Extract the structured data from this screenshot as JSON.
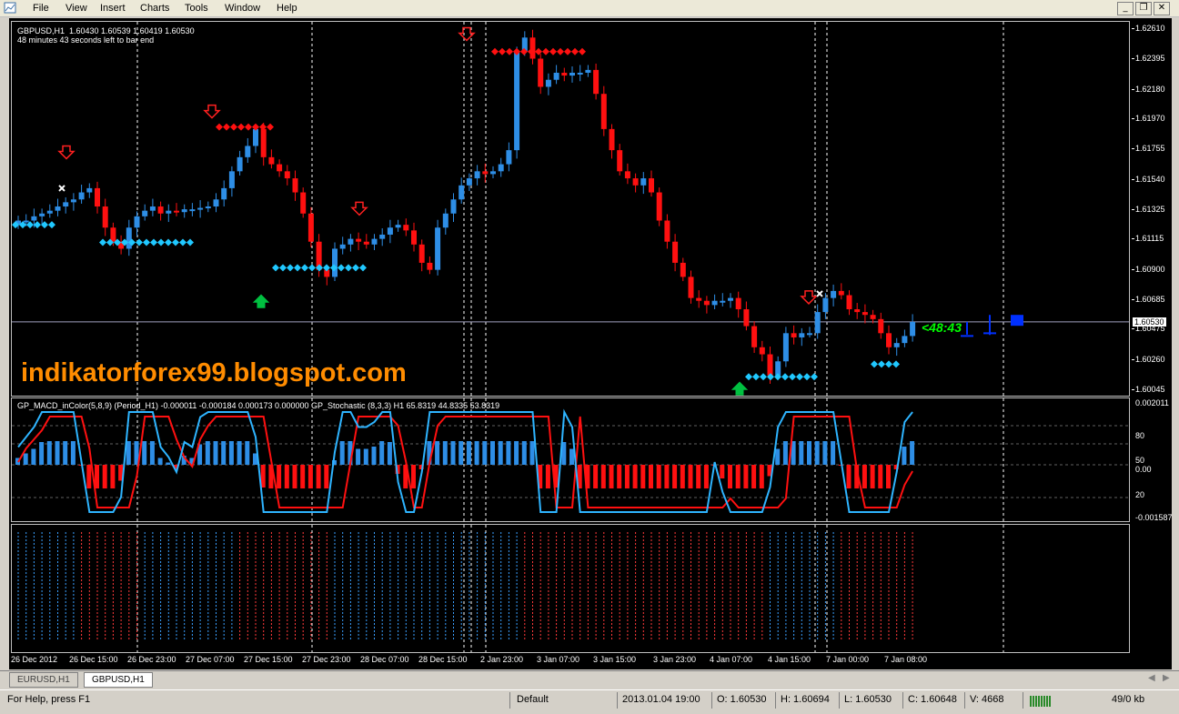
{
  "menu": {
    "items": [
      "File",
      "View",
      "Insert",
      "Charts",
      "Tools",
      "Window",
      "Help"
    ]
  },
  "window_controls": {
    "minimize": "_",
    "restore": "❐",
    "close": "✕"
  },
  "chart": {
    "symbol_line": "GBPUSD,H1  1.60430 1.60539 1.60419 1.60530",
    "timer_line": "48 minutes 43 seconds left to bar end",
    "watermark": "indikatorforex99.blogspot.com",
    "countdown": "<48:43",
    "current_price": "1.60530",
    "price_labels": [
      "1.62610",
      "1.62395",
      "1.62180",
      "1.61970",
      "1.61755",
      "1.61540",
      "1.61325",
      "1.61115",
      "1.60900",
      "1.60685",
      "1.60475",
      "1.60260",
      "1.60045"
    ],
    "price_low": 1.60045,
    "price_high": 1.6261,
    "colors": {
      "bull": "#2e8ee6",
      "bear": "#ff1010",
      "diamond_bull": "#20c8ff",
      "diamond_bear": "#ff1010",
      "grid": "#ffffff",
      "signal_up": "#00c040"
    }
  },
  "macd": {
    "info": "GP_MACD_inColor(5,8,9) (Period_H1) -0.000011 -0.000184 0.000173 0.000000  GP_Stochastic (8,3,3) H1 65.8319 44.8335 53.8319",
    "scale_labels": [
      "0.002011",
      "80",
      "50",
      "0.00",
      "20",
      "-0.001587"
    ]
  },
  "time_axis": {
    "labels": [
      "26 Dec 2012",
      "26 Dec 15:00",
      "26 Dec 23:00",
      "27 Dec 07:00",
      "27 Dec 15:00",
      "27 Dec 23:00",
      "28 Dec 07:00",
      "28 Dec 15:00",
      "2 Jan 23:00",
      "3 Jan 07:00",
      "3 Jan 15:00",
      "3 Jan 23:00",
      "4 Jan 07:00",
      "4 Jan 15:00",
      "7 Jan 00:00",
      "7 Jan 08:00"
    ]
  },
  "chart_data": {
    "type": "candlestick",
    "symbol": "GBPUSD",
    "timeframe": "H1",
    "ylim": [
      1.60045,
      1.6261
    ],
    "close_series": [
      1.6125,
      1.6125,
      1.6128,
      1.613,
      1.6132,
      1.6135,
      1.6138,
      1.614,
      1.6145,
      1.6148,
      1.6135,
      1.612,
      1.611,
      1.6105,
      1.612,
      1.6128,
      1.6132,
      1.6135,
      1.613,
      1.6132,
      1.6131,
      1.6133,
      1.6133,
      1.6134,
      1.6135,
      1.614,
      1.6148,
      1.616,
      1.617,
      1.6178,
      1.619,
      1.617,
      1.6165,
      1.616,
      1.6155,
      1.6145,
      1.613,
      1.611,
      1.609,
      1.6085,
      1.6105,
      1.6108,
      1.6112,
      1.611,
      1.6108,
      1.6112,
      1.6115,
      1.612,
      1.6122,
      1.6118,
      1.6108,
      1.6095,
      1.609,
      1.612,
      1.613,
      1.614,
      1.615,
      1.6155,
      1.616,
      1.6158,
      1.616,
      1.6165,
      1.6175,
      1.6245,
      1.6255,
      1.624,
      1.622,
      1.6225,
      1.623,
      1.6228,
      1.623,
      1.623,
      1.6232,
      1.6215,
      1.619,
      1.6175,
      1.616,
      1.6155,
      1.615,
      1.6155,
      1.6145,
      1.6125,
      1.611,
      1.6095,
      1.6085,
      1.607,
      1.6068,
      1.6065,
      1.6068,
      1.6068,
      1.607,
      1.6062,
      1.605,
      1.6035,
      1.603,
      1.6015,
      1.6025,
      1.6045,
      1.6042,
      1.6045,
      1.6045,
      1.606,
      1.607,
      1.6075,
      1.6072,
      1.6062,
      1.606,
      1.6058,
      1.6055,
      1.6045,
      1.6035,
      1.6038,
      1.6043,
      1.6053
    ],
    "signals": [
      {
        "type": "sell",
        "label": "diamond-line-bear"
      },
      {
        "type": "buy",
        "label": "diamond-line-bull"
      }
    ]
  },
  "tabs": [
    {
      "label": "EURUSD,H1",
      "active": false
    },
    {
      "label": "GBPUSD,H1",
      "active": true
    }
  ],
  "status": {
    "help": "For Help, press F1",
    "profile": "Default",
    "datetime": "2013.01.04 19:00",
    "open": "O: 1.60530",
    "high": "H: 1.60694",
    "low": "L: 1.60530",
    "close": "C: 1.60648",
    "volume": "V: 4668",
    "traffic": "49/0 kb"
  }
}
